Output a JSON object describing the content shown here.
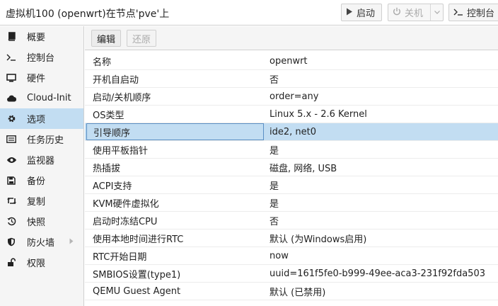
{
  "header": {
    "title": "虚拟机100 (openwrt)在节点'pve'上",
    "start_label": "启动",
    "shutdown_label": "关机",
    "console_label": "控制台",
    "icons": {
      "start": "play-icon",
      "shutdown": "power-icon",
      "console": "terminal-icon",
      "dropdown": "chevron-down-icon"
    }
  },
  "sidebar": {
    "items": [
      {
        "label": "概要",
        "icon": "book-icon"
      },
      {
        "label": "控制台",
        "icon": "terminal-icon"
      },
      {
        "label": "硬件",
        "icon": "monitor-icon"
      },
      {
        "label": "Cloud-Init",
        "icon": "cloud-icon"
      },
      {
        "label": "选项",
        "icon": "gear-icon",
        "active": true
      },
      {
        "label": "任务历史",
        "icon": "list-icon"
      },
      {
        "label": "监视器",
        "icon": "eye-icon"
      },
      {
        "label": "备份",
        "icon": "floppy-icon"
      },
      {
        "label": "复制",
        "icon": "retweet-icon"
      },
      {
        "label": "快照",
        "icon": "history-icon"
      },
      {
        "label": "防火墙",
        "icon": "shield-icon",
        "has_submenu": true
      },
      {
        "label": "权限",
        "icon": "unlock-icon"
      }
    ]
  },
  "toolbar": {
    "edit_label": "编辑",
    "revert_label": "还原"
  },
  "options": {
    "rows": [
      {
        "key": "名称",
        "value": "openwrt"
      },
      {
        "key": "开机自启动",
        "value": "否"
      },
      {
        "key": "启动/关机顺序",
        "value": "order=any"
      },
      {
        "key": "OS类型",
        "value": "Linux 5.x - 2.6 Kernel"
      },
      {
        "key": "引导顺序",
        "value": "ide2, net0",
        "selected": true
      },
      {
        "key": "使用平板指针",
        "value": "是"
      },
      {
        "key": "热插拔",
        "value": "磁盘, 网络, USB"
      },
      {
        "key": "ACPI支持",
        "value": "是"
      },
      {
        "key": "KVM硬件虚拟化",
        "value": "是"
      },
      {
        "key": "启动时冻结CPU",
        "value": "否"
      },
      {
        "key": "使用本地时间进行RTC",
        "value": "默认 (为Windows启用)"
      },
      {
        "key": "RTC开始日期",
        "value": "now"
      },
      {
        "key": "SMBIOS设置(type1)",
        "value": "uuid=161f5fe0-b999-49ee-aca3-231f92fda503"
      },
      {
        "key": "QEMU Guest Agent",
        "value": "默认 (已禁用)"
      }
    ]
  },
  "colors": {
    "selection": "#c2ddf2",
    "selection_border": "#5a8fc4"
  }
}
